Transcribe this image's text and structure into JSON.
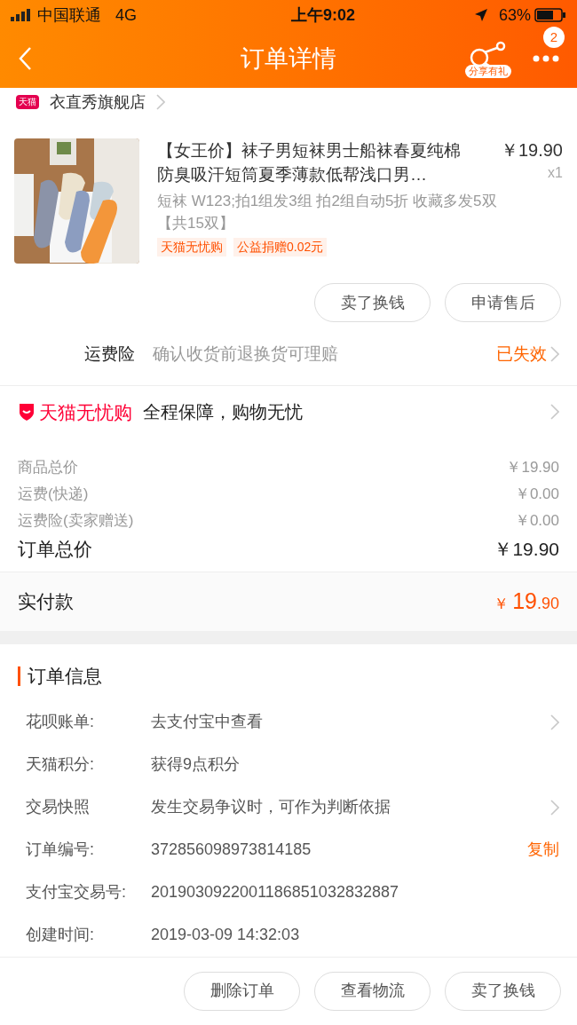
{
  "status_bar": {
    "carrier": "中国联通",
    "network": "4G",
    "time": "上午9:02",
    "battery": "63%"
  },
  "nav": {
    "title": "订单详情",
    "share_label": "分享有礼",
    "badge": "2"
  },
  "store": {
    "badge": "天猫",
    "name": "衣直秀旗舰店"
  },
  "product": {
    "kind": "picture",
    "title": "【女王价】袜子男短袜男士船袜春夏纯棉防臭吸汗短筒夏季薄款低帮浅口男…",
    "price": "￥19.90",
    "quantity": "x1",
    "sku": "短袜 W123;拍1组发3组 拍2组自动5折 收藏多发5双【共15双】",
    "tags": [
      "天猫无忧购",
      "公益捐赠0.02元"
    ]
  },
  "item_buttons": [
    "卖了换钱",
    "申请售后"
  ],
  "shipping_insurance": {
    "label": "运费险",
    "description": "确认收货前退换货可理赔",
    "status": "已失效"
  },
  "guarantee": {
    "brand": "天猫无忧购",
    "text": "全程保障，购物无忧"
  },
  "price_rows": [
    {
      "label": "商品总价",
      "value": "￥19.90"
    },
    {
      "label": "运费(快递)",
      "value": "￥0.00"
    },
    {
      "label": "运费险(卖家赠送)",
      "value": "￥0.00"
    }
  ],
  "order_total": {
    "label": "订单总价",
    "value": "￥19.90"
  },
  "paid": {
    "label": "实付款",
    "currency": "￥",
    "integer": "19",
    "decimal": ".90"
  },
  "order_info": {
    "title": "订单信息",
    "rows": [
      {
        "label": "花呗账单:",
        "value": "去支付宝中查看",
        "kind": "link"
      },
      {
        "label": "天猫积分:",
        "value": "获得9点积分",
        "kind": "plain"
      },
      {
        "label": "交易快照",
        "value": "发生交易争议时，可作为判断依据",
        "kind": "link"
      },
      {
        "label": "订单编号:",
        "value": "372856098973814185",
        "kind": "copy",
        "action": "复制"
      },
      {
        "label": "支付宝交易号:",
        "value": "2019030922001186851032832887",
        "kind": "plain"
      },
      {
        "label": "创建时间:",
        "value": "2019-03-09 14:32:03",
        "kind": "plain"
      }
    ]
  },
  "bottom_buttons": [
    "删除订单",
    "查看物流",
    "卖了换钱"
  ]
}
